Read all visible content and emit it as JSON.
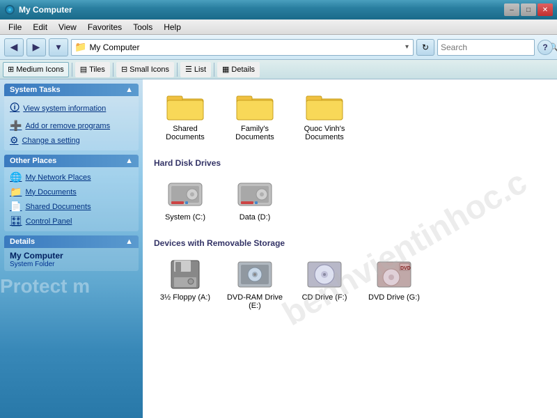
{
  "titleBar": {
    "title": "My Computer",
    "minLabel": "–",
    "maxLabel": "□",
    "closeLabel": "✕"
  },
  "menuBar": {
    "items": [
      "File",
      "Edit",
      "View",
      "Favorites",
      "Tools",
      "Help"
    ]
  },
  "toolbar": {
    "backLabel": "◀",
    "forwardLabel": "▶",
    "dropdownLabel": "▾",
    "refreshLabel": "↻",
    "addressIcon": "📁",
    "addressText": "My Computer",
    "searchPlaceholder": "Search",
    "searchBtnLabel": "🔍",
    "helpLabel": "?"
  },
  "viewToolbar": {
    "buttons": [
      {
        "id": "medium-icons",
        "icon": "⊞",
        "label": "Medium Icons",
        "active": true
      },
      {
        "id": "tiles",
        "icon": "▤",
        "label": "Tiles"
      },
      {
        "id": "small-icons",
        "icon": "⊟",
        "label": "Small Icons"
      },
      {
        "id": "list",
        "icon": "☰",
        "label": "List"
      },
      {
        "id": "details",
        "icon": "▦",
        "label": "Details"
      }
    ]
  },
  "sidebar": {
    "systemTasksHeader": "System Tasks",
    "systemTasksLinks": [
      {
        "icon": "🛈",
        "label": "View system information"
      },
      {
        "icon": "➕",
        "label": "Add or remove programs"
      },
      {
        "icon": "⚙",
        "label": "Change a setting"
      }
    ],
    "otherPlacesHeader": "Other Places",
    "otherPlacesLinks": [
      {
        "icon": "🌐",
        "label": "My Network Places"
      },
      {
        "icon": "📁",
        "label": "My Documents"
      },
      {
        "icon": "📄",
        "label": "Shared Documents"
      },
      {
        "icon": "🎛",
        "label": "Control Panel"
      }
    ],
    "detailsHeader": "Details",
    "detailsTitle": "My Computer",
    "detailsSubtitle": "System Folder",
    "protectText": "Protect m"
  },
  "content": {
    "folders": [
      {
        "label": "Shared Documents"
      },
      {
        "label": "Family's Documents"
      },
      {
        "label": "Quoc Vinh's Documents"
      }
    ],
    "hardDiskHeader": "Hard Disk Drives",
    "hardDisks": [
      {
        "label": "System (C:)",
        "type": "hdd"
      },
      {
        "label": "Data (D:)",
        "type": "hdd"
      }
    ],
    "removableHeader": "Devices with Removable Storage",
    "removable": [
      {
        "label": "3½ Floppy (A:)",
        "type": "floppy"
      },
      {
        "label": "DVD-RAM Drive (E:)",
        "type": "dvdram"
      },
      {
        "label": "CD Drive (F:)",
        "type": "cd"
      },
      {
        "label": "DVD Drive (G:)",
        "type": "dvd"
      }
    ]
  }
}
